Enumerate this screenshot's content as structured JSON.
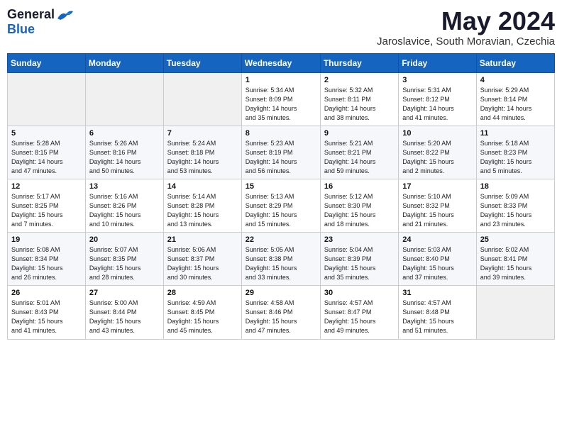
{
  "logo": {
    "general": "General",
    "blue": "Blue"
  },
  "title": {
    "month_year": "May 2024",
    "location": "Jaroslavice, South Moravian, Czechia"
  },
  "days_of_week": [
    "Sunday",
    "Monday",
    "Tuesday",
    "Wednesday",
    "Thursday",
    "Friday",
    "Saturday"
  ],
  "weeks": [
    [
      {
        "day": "",
        "info": ""
      },
      {
        "day": "",
        "info": ""
      },
      {
        "day": "",
        "info": ""
      },
      {
        "day": "1",
        "info": "Sunrise: 5:34 AM\nSunset: 8:09 PM\nDaylight: 14 hours\nand 35 minutes."
      },
      {
        "day": "2",
        "info": "Sunrise: 5:32 AM\nSunset: 8:11 PM\nDaylight: 14 hours\nand 38 minutes."
      },
      {
        "day": "3",
        "info": "Sunrise: 5:31 AM\nSunset: 8:12 PM\nDaylight: 14 hours\nand 41 minutes."
      },
      {
        "day": "4",
        "info": "Sunrise: 5:29 AM\nSunset: 8:14 PM\nDaylight: 14 hours\nand 44 minutes."
      }
    ],
    [
      {
        "day": "5",
        "info": "Sunrise: 5:28 AM\nSunset: 8:15 PM\nDaylight: 14 hours\nand 47 minutes."
      },
      {
        "day": "6",
        "info": "Sunrise: 5:26 AM\nSunset: 8:16 PM\nDaylight: 14 hours\nand 50 minutes."
      },
      {
        "day": "7",
        "info": "Sunrise: 5:24 AM\nSunset: 8:18 PM\nDaylight: 14 hours\nand 53 minutes."
      },
      {
        "day": "8",
        "info": "Sunrise: 5:23 AM\nSunset: 8:19 PM\nDaylight: 14 hours\nand 56 minutes."
      },
      {
        "day": "9",
        "info": "Sunrise: 5:21 AM\nSunset: 8:21 PM\nDaylight: 14 hours\nand 59 minutes."
      },
      {
        "day": "10",
        "info": "Sunrise: 5:20 AM\nSunset: 8:22 PM\nDaylight: 15 hours\nand 2 minutes."
      },
      {
        "day": "11",
        "info": "Sunrise: 5:18 AM\nSunset: 8:23 PM\nDaylight: 15 hours\nand 5 minutes."
      }
    ],
    [
      {
        "day": "12",
        "info": "Sunrise: 5:17 AM\nSunset: 8:25 PM\nDaylight: 15 hours\nand 7 minutes."
      },
      {
        "day": "13",
        "info": "Sunrise: 5:16 AM\nSunset: 8:26 PM\nDaylight: 15 hours\nand 10 minutes."
      },
      {
        "day": "14",
        "info": "Sunrise: 5:14 AM\nSunset: 8:28 PM\nDaylight: 15 hours\nand 13 minutes."
      },
      {
        "day": "15",
        "info": "Sunrise: 5:13 AM\nSunset: 8:29 PM\nDaylight: 15 hours\nand 15 minutes."
      },
      {
        "day": "16",
        "info": "Sunrise: 5:12 AM\nSunset: 8:30 PM\nDaylight: 15 hours\nand 18 minutes."
      },
      {
        "day": "17",
        "info": "Sunrise: 5:10 AM\nSunset: 8:32 PM\nDaylight: 15 hours\nand 21 minutes."
      },
      {
        "day": "18",
        "info": "Sunrise: 5:09 AM\nSunset: 8:33 PM\nDaylight: 15 hours\nand 23 minutes."
      }
    ],
    [
      {
        "day": "19",
        "info": "Sunrise: 5:08 AM\nSunset: 8:34 PM\nDaylight: 15 hours\nand 26 minutes."
      },
      {
        "day": "20",
        "info": "Sunrise: 5:07 AM\nSunset: 8:35 PM\nDaylight: 15 hours\nand 28 minutes."
      },
      {
        "day": "21",
        "info": "Sunrise: 5:06 AM\nSunset: 8:37 PM\nDaylight: 15 hours\nand 30 minutes."
      },
      {
        "day": "22",
        "info": "Sunrise: 5:05 AM\nSunset: 8:38 PM\nDaylight: 15 hours\nand 33 minutes."
      },
      {
        "day": "23",
        "info": "Sunrise: 5:04 AM\nSunset: 8:39 PM\nDaylight: 15 hours\nand 35 minutes."
      },
      {
        "day": "24",
        "info": "Sunrise: 5:03 AM\nSunset: 8:40 PM\nDaylight: 15 hours\nand 37 minutes."
      },
      {
        "day": "25",
        "info": "Sunrise: 5:02 AM\nSunset: 8:41 PM\nDaylight: 15 hours\nand 39 minutes."
      }
    ],
    [
      {
        "day": "26",
        "info": "Sunrise: 5:01 AM\nSunset: 8:43 PM\nDaylight: 15 hours\nand 41 minutes."
      },
      {
        "day": "27",
        "info": "Sunrise: 5:00 AM\nSunset: 8:44 PM\nDaylight: 15 hours\nand 43 minutes."
      },
      {
        "day": "28",
        "info": "Sunrise: 4:59 AM\nSunset: 8:45 PM\nDaylight: 15 hours\nand 45 minutes."
      },
      {
        "day": "29",
        "info": "Sunrise: 4:58 AM\nSunset: 8:46 PM\nDaylight: 15 hours\nand 47 minutes."
      },
      {
        "day": "30",
        "info": "Sunrise: 4:57 AM\nSunset: 8:47 PM\nDaylight: 15 hours\nand 49 minutes."
      },
      {
        "day": "31",
        "info": "Sunrise: 4:57 AM\nSunset: 8:48 PM\nDaylight: 15 hours\nand 51 minutes."
      },
      {
        "day": "",
        "info": ""
      }
    ]
  ]
}
